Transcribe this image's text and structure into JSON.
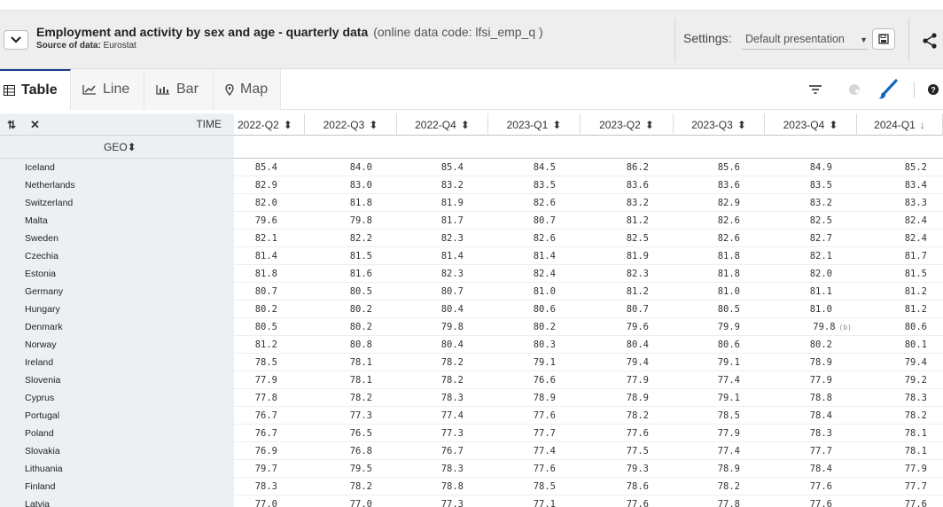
{
  "header": {
    "title": "Employment and activity by sex and age - quarterly data",
    "code": "(online data code: lfsi_emp_q )",
    "source_label": "Source of data:",
    "source_value": "Eurostat",
    "settings_label": "Settings:",
    "settings_value": "Default presentation"
  },
  "tabs": [
    {
      "label": "Table",
      "icon": "table-icon",
      "active": true
    },
    {
      "label": "Line",
      "icon": "line-chart-icon",
      "active": false
    },
    {
      "label": "Bar",
      "icon": "bar-chart-icon",
      "active": false
    },
    {
      "label": "Map",
      "icon": "map-pin-icon",
      "active": false
    }
  ],
  "table": {
    "time_label": "TIME",
    "geo_label": "GEO",
    "columns": [
      "2022-Q2",
      "2022-Q3",
      "2022-Q4",
      "2023-Q1",
      "2023-Q2",
      "2023-Q3",
      "2023-Q4",
      "2024-Q1"
    ],
    "sort_column": "2024-Q1",
    "rows": [
      {
        "geo": "Iceland",
        "values": [
          "85.4",
          "84.0",
          "85.4",
          "84.5",
          "86.2",
          "85.6",
          "84.9",
          "85.2"
        ]
      },
      {
        "geo": "Netherlands",
        "values": [
          "82.9",
          "83.0",
          "83.2",
          "83.5",
          "83.6",
          "83.6",
          "83.5",
          "83.4"
        ]
      },
      {
        "geo": "Switzerland",
        "values": [
          "82.0",
          "81.8",
          "81.9",
          "82.6",
          "83.2",
          "82.9",
          "83.2",
          "83.3"
        ]
      },
      {
        "geo": "Malta",
        "values": [
          "79.6",
          "79.8",
          "81.7",
          "80.7",
          "81.2",
          "82.6",
          "82.5",
          "82.4"
        ]
      },
      {
        "geo": "Sweden",
        "values": [
          "82.1",
          "82.2",
          "82.3",
          "82.6",
          "82.5",
          "82.6",
          "82.7",
          "82.4"
        ]
      },
      {
        "geo": "Czechia",
        "values": [
          "81.4",
          "81.5",
          "81.4",
          "81.4",
          "81.9",
          "81.8",
          "82.1",
          "81.7"
        ]
      },
      {
        "geo": "Estonia",
        "values": [
          "81.8",
          "81.6",
          "82.3",
          "82.4",
          "82.3",
          "81.8",
          "82.0",
          "81.5"
        ]
      },
      {
        "geo": "Germany",
        "values": [
          "80.7",
          "80.5",
          "80.7",
          "81.0",
          "81.2",
          "81.0",
          "81.1",
          "81.2"
        ]
      },
      {
        "geo": "Hungary",
        "values": [
          "80.2",
          "80.2",
          "80.4",
          "80.6",
          "80.7",
          "80.5",
          "81.0",
          "81.2"
        ]
      },
      {
        "geo": "Denmark",
        "values": [
          "80.5",
          "80.2",
          "79.8",
          "80.2",
          "79.6",
          "79.9",
          "79.8",
          "80.6"
        ],
        "flags": [
          "",
          "",
          "",
          "",
          "",
          "",
          "(b)",
          ""
        ]
      },
      {
        "geo": "Norway",
        "values": [
          "81.2",
          "80.8",
          "80.4",
          "80.3",
          "80.4",
          "80.6",
          "80.2",
          "80.1"
        ]
      },
      {
        "geo": "Ireland",
        "values": [
          "78.5",
          "78.1",
          "78.2",
          "79.1",
          "79.4",
          "79.1",
          "78.9",
          "79.4"
        ]
      },
      {
        "geo": "Slovenia",
        "values": [
          "77.9",
          "78.1",
          "78.2",
          "76.6",
          "77.9",
          "77.4",
          "77.9",
          "79.2"
        ]
      },
      {
        "geo": "Cyprus",
        "values": [
          "77.8",
          "78.2",
          "78.3",
          "78.9",
          "78.9",
          "79.1",
          "78.8",
          "78.3"
        ]
      },
      {
        "geo": "Portugal",
        "values": [
          "76.7",
          "77.3",
          "77.4",
          "77.6",
          "78.2",
          "78.5",
          "78.4",
          "78.2"
        ]
      },
      {
        "geo": "Poland",
        "values": [
          "76.7",
          "76.5",
          "77.3",
          "77.7",
          "77.6",
          "77.9",
          "78.3",
          "78.1"
        ]
      },
      {
        "geo": "Slovakia",
        "values": [
          "76.9",
          "76.8",
          "76.7",
          "77.4",
          "77.5",
          "77.4",
          "77.7",
          "78.1"
        ]
      },
      {
        "geo": "Lithuania",
        "values": [
          "79.7",
          "79.5",
          "78.3",
          "77.6",
          "79.3",
          "78.9",
          "78.4",
          "77.9"
        ]
      },
      {
        "geo": "Finland",
        "values": [
          "78.3",
          "78.2",
          "78.8",
          "78.5",
          "78.6",
          "78.2",
          "77.6",
          "77.7"
        ]
      },
      {
        "geo": "Latvia",
        "values": [
          "77.0",
          "77.0",
          "77.3",
          "77.1",
          "77.6",
          "77.8",
          "77.6",
          "77.6"
        ]
      }
    ]
  },
  "colors": {
    "accent": "#1a3d8c",
    "brush": "#1565c0",
    "header_bg": "#eeeeee",
    "geo_col_bg": "#edf0f3"
  }
}
